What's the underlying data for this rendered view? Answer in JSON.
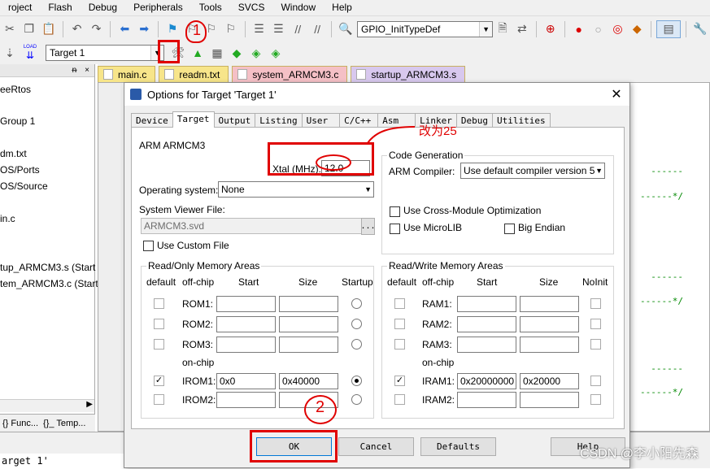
{
  "menu": [
    "roject",
    "Flash",
    "Debug",
    "Peripherals",
    "Tools",
    "SVCS",
    "Window",
    "Help"
  ],
  "toolbar1": {
    "symbol_combo": "GPIO_InitTypeDef"
  },
  "toolbar2": {
    "load_label": "LOAD",
    "target_combo": "Target 1"
  },
  "left_pane": {
    "items": [
      "eeRtos",
      "Group 1",
      "dm.txt",
      "OS/Ports",
      "OS/Source",
      "in.c",
      "tup_ARMCM3.s (Start",
      "tem_ARMCM3.c (Start"
    ],
    "tabs": [
      "{} Func...",
      "{}_ Temp..."
    ],
    "pin": "ᵰ",
    "close": "×"
  },
  "editor_tabs": [
    {
      "label": "main.c",
      "color": "#f7e58a"
    },
    {
      "label": "readm.txt",
      "color": "#f7e58a"
    },
    {
      "label": "system_ARMCM3.c",
      "color": "#f5c0c6"
    },
    {
      "label": "startup_ARMCM3.s",
      "color": "#d8c8ee"
    }
  ],
  "editor_lines": [
    "------",
    "------*/",
    "------",
    "------*/",
    "------",
    "------*/"
  ],
  "status": "arget 1'",
  "dialog": {
    "title": "Options for Target 'Target 1'",
    "close": "✕",
    "tabs": [
      "Device",
      "Target",
      "Output",
      "Listing",
      "User",
      "C/C++",
      "Asm",
      "Linker",
      "Debug",
      "Utilities"
    ],
    "active_tab": "Target",
    "device": "ARM ARMCM3",
    "xtal_label": "Xtal (MHz):",
    "xtal_value": "12.0",
    "os_label": "Operating system:",
    "os_value": "None",
    "svd_label": "System Viewer File:",
    "svd_value": "ARMCM3.svd",
    "svd_browse": "...",
    "custom_file_label": "Use Custom File",
    "code_gen": {
      "title": "Code Generation",
      "compiler_label": "ARM Compiler:",
      "compiler_value": "Use default compiler version 5",
      "cross_module": "Use Cross-Module Optimization",
      "microlib": "Use MicroLIB",
      "big_endian": "Big Endian"
    },
    "rom": {
      "title": "Read/Only Memory Areas",
      "headers": {
        "default": "default",
        "offchip": "off-chip",
        "start": "Start",
        "size": "Size",
        "startup": "Startup"
      },
      "onchip_label": "on-chip",
      "rows": [
        {
          "name": "ROM1:",
          "start": "",
          "size": "",
          "default": false,
          "startup": false
        },
        {
          "name": "ROM2:",
          "start": "",
          "size": "",
          "default": false,
          "startup": false
        },
        {
          "name": "ROM3:",
          "start": "",
          "size": "",
          "default": false,
          "startup": false
        },
        {
          "name": "IROM1:",
          "start": "0x0",
          "size": "0x40000",
          "default": true,
          "startup": true
        },
        {
          "name": "IROM2:",
          "start": "",
          "size": "",
          "default": false,
          "startup": false
        }
      ]
    },
    "ram": {
      "title": "Read/Write Memory Areas",
      "headers": {
        "default": "default",
        "offchip": "off-chip",
        "start": "Start",
        "size": "Size",
        "noinit": "NoInit"
      },
      "onchip_label": "on-chip",
      "rows": [
        {
          "name": "RAM1:",
          "start": "",
          "size": "",
          "default": false
        },
        {
          "name": "RAM2:",
          "start": "",
          "size": "",
          "default": false
        },
        {
          "name": "RAM3:",
          "start": "",
          "size": "",
          "default": false
        },
        {
          "name": "IRAM1:",
          "start": "0x20000000",
          "size": "0x20000",
          "default": true
        },
        {
          "name": "IRAM2:",
          "start": "",
          "size": "",
          "default": false
        }
      ]
    },
    "buttons": {
      "ok": "OK",
      "cancel": "Cancel",
      "defaults": "Defaults",
      "help": "Help"
    }
  },
  "annotations": {
    "change_note": "改为25",
    "step1": "1",
    "step2": "2"
  },
  "watermark": "CSDN @李小阳先森",
  "colors": {
    "annotation": "#e00000",
    "code_comment": "#008000"
  }
}
